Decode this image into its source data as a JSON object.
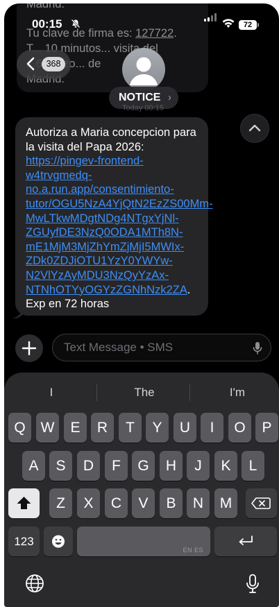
{
  "status_bar": {
    "time": "00:15",
    "battery": "72"
  },
  "previous_message": {
    "line_top": "Madrid.",
    "line1_prefix": "Tu clave de firma es: ",
    "code": "127722",
    "line1_suffix": ".",
    "line2": "T... 10 minutos... visita del",
    "line3": "...6 - Arzo... de",
    "line4": "Madrid."
  },
  "header": {
    "back_count": "368",
    "contact_name": "NOTICE",
    "date_label": "Today 00:15"
  },
  "message": {
    "text_intro": "Autoriza a Maria concepcion para la visita del Papa 2026: ",
    "link_lines": [
      "https://pingev-frontend-",
      "w4trvgmedq-no.a.run.app/",
      "consentimiento-tutor/",
      "OGU5NzA4YjQtN2EzZS00Mm-",
      "MwLTkwMDgtNDg4NTgxYjNl-",
      "ZGUyfDE3NzQ0ODA1MTh8N-",
      "mE1MjM3MjZhYmZjMjI5MWIx-",
      "ZDk0ZDJiOTU1YzY0YWYw-",
      "N2VlYzAyMDU3NzQyYzAx-",
      "NTNhOTYyOGYzZGNhNzk2ZA"
    ],
    "text_after_link": ".",
    "text_end": "Exp en 72 horas"
  },
  "compose": {
    "placeholder": "Text Message • SMS"
  },
  "keyboard": {
    "suggestions": [
      "I",
      "The",
      "I'm"
    ],
    "row1": [
      "Q",
      "W",
      "E",
      "R",
      "T",
      "Y",
      "U",
      "I",
      "O",
      "P"
    ],
    "row2": [
      "A",
      "S",
      "D",
      "F",
      "G",
      "H",
      "J",
      "K",
      "L"
    ],
    "row3": [
      "Z",
      "X",
      "C",
      "V",
      "B",
      "N",
      "M"
    ],
    "numbers_label": "123",
    "language_label": "EN ES"
  }
}
